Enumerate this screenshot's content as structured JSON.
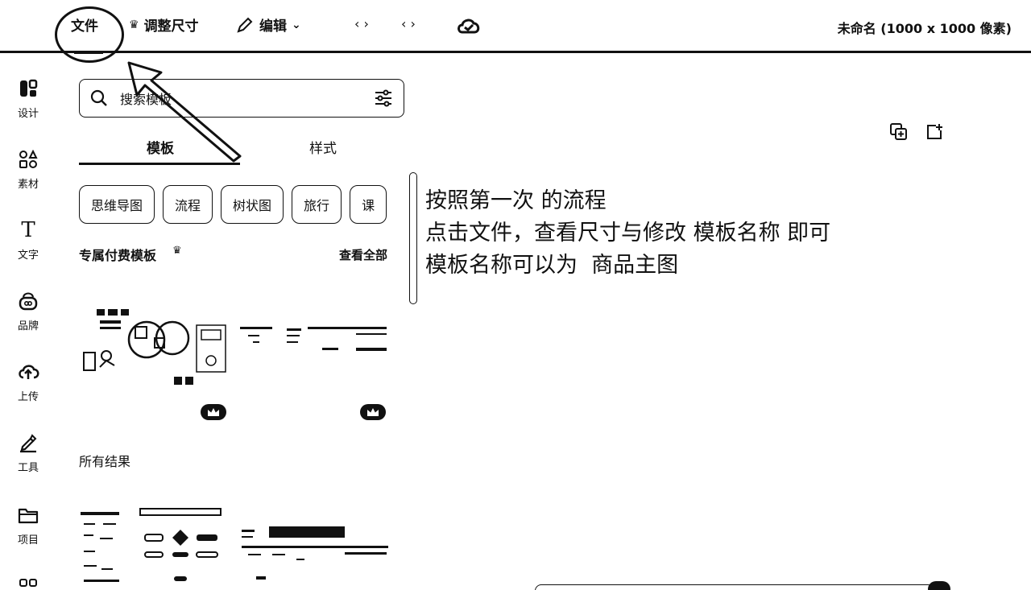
{
  "topbar": {
    "file_label": "文件",
    "resize_label": "调整尺寸",
    "edit_label": "编辑",
    "undo_glyph": "‹ ›",
    "redo_glyph": "‹ ›",
    "doc_title": "未命名 (1000 x 1000 像素)"
  },
  "sidebar": {
    "items": [
      {
        "label": "设计",
        "icon": "design-icon"
      },
      {
        "label": "素材",
        "icon": "elements-icon"
      },
      {
        "label": "文字",
        "icon": "text-icon"
      },
      {
        "label": "品牌",
        "icon": "brand-icon"
      },
      {
        "label": "上传",
        "icon": "upload-icon"
      },
      {
        "label": "工具",
        "icon": "tools-icon"
      },
      {
        "label": "项目",
        "icon": "folder-icon"
      }
    ]
  },
  "search": {
    "placeholder": "搜索模板"
  },
  "tabs": [
    {
      "label": "模板",
      "active": true
    },
    {
      "label": "样式",
      "active": false
    }
  ],
  "chips": [
    "思维导图",
    "流程",
    "树状图",
    "旅行",
    "课"
  ],
  "sections": {
    "premium_title": "专属付费模板",
    "see_all": "查看全部",
    "all_results": "所有结果"
  },
  "annotation": {
    "line1": "按照第一次 的流程",
    "line2": "点击文件，查看尺寸与修改 模板名称 即可",
    "line3": "模板名称可以为  商品主图"
  }
}
